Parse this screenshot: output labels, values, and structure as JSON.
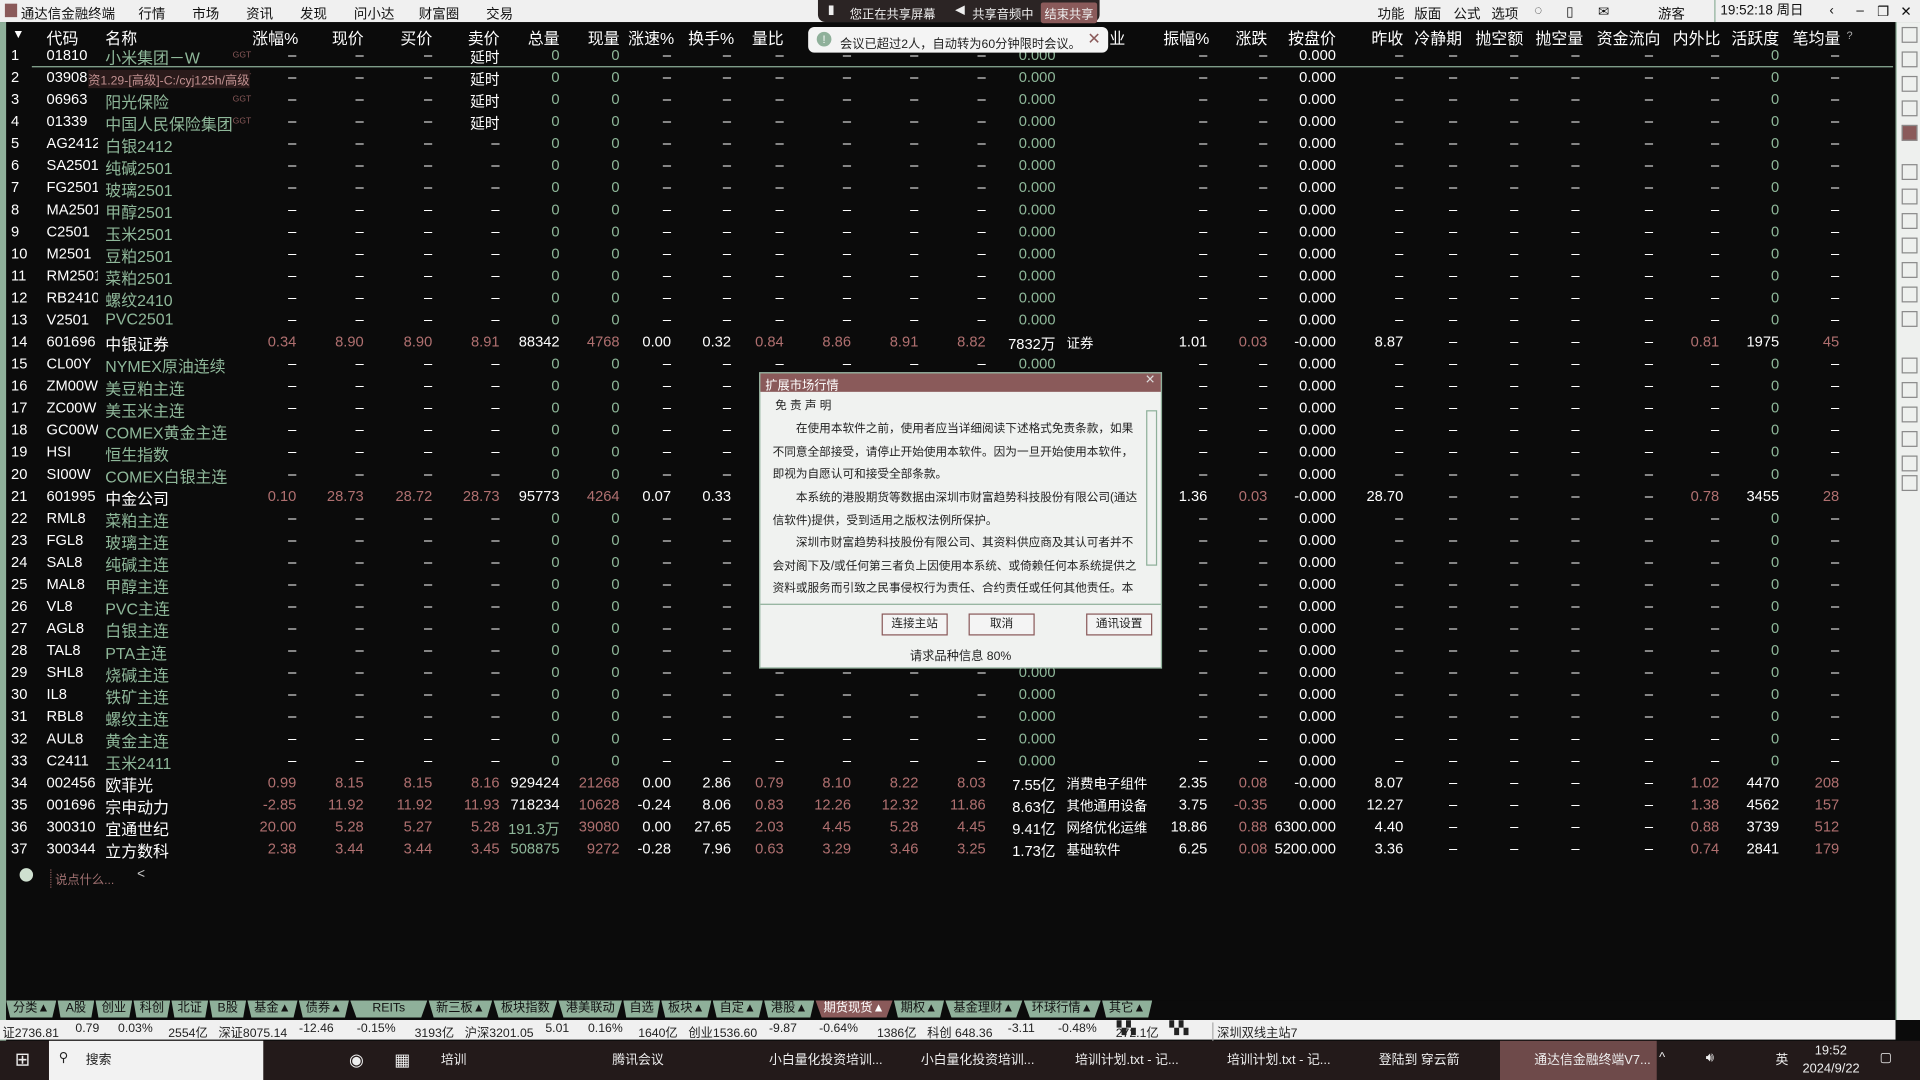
{
  "app": {
    "title": "通达信金融终端",
    "menu": [
      "行情",
      "市场",
      "资讯",
      "发现",
      "问小达",
      "财富圈",
      "交易"
    ],
    "right_menu": [
      "功能",
      "版面",
      "公式",
      "选项"
    ],
    "user": "游客",
    "clock": "19:52:18 周日"
  },
  "share_bar": {
    "sharing": "您正在共享屏幕",
    "audio": "共享音频中",
    "end": "结束共享"
  },
  "toast": {
    "text": "会议已超过2人，自动转为60分钟限时会议。"
  },
  "table": {
    "headers": {
      "code": "代码",
      "name": "名称",
      "chg": "涨幅%",
      "price": "现价",
      "bid": "买价",
      "ask": "卖价",
      "vol": "总量",
      "curvol": "现量",
      "speed": "涨速%",
      "turnover": "换手%",
      "volratio": "量比",
      "industry_tail": "业",
      "amp": "振幅%",
      "change": "涨跌",
      "ref": "按盘价",
      "prev": "昨收",
      "cool": "冷静期",
      "shortamt": "抛空额",
      "shortvol": "抛空量",
      "flow": "资金流向",
      "inout": "内外比",
      "activity": "活跃度",
      "avgvol": "笔均量",
      "help": "?"
    },
    "overlay_title": "资1.29-[高级]-C:/cyj125h/高级",
    "rows": [
      [
        "1",
        "01810",
        "小米集团－W",
        "GGT"
      ],
      [
        "2",
        "03908",
        "",
        "GGT"
      ],
      [
        "3",
        "06963",
        "阳光保险",
        "GGT"
      ],
      [
        "4",
        "01339",
        "中国人民保险集团",
        "GGT"
      ],
      [
        "5",
        "AG2412",
        "白银2412"
      ],
      [
        "6",
        "SA2501",
        "纯碱2501"
      ],
      [
        "7",
        "FG2501",
        "玻璃2501"
      ],
      [
        "8",
        "MA2501",
        "甲醇2501"
      ],
      [
        "9",
        "C2501",
        "玉米2501"
      ],
      [
        "10",
        "M2501",
        "豆粕2501"
      ],
      [
        "11",
        "RM2501",
        "菜粕2501"
      ],
      [
        "12",
        "RB2410",
        "螺纹2410"
      ],
      [
        "13",
        "V2501",
        "PVC2501"
      ],
      [
        "14",
        "601696",
        "中银证券",
        "",
        "0.34",
        "8.90",
        "8.90",
        "8.91",
        "88342",
        "4768",
        "0.00",
        "0.32",
        "0.84",
        "8.86",
        "8.91",
        "8.82",
        "7832万",
        "证券",
        "1.01",
        "0.03",
        "-0.000",
        "8.87",
        "–",
        "–",
        "–",
        "–",
        "0.81",
        "1975",
        "45"
      ],
      [
        "15",
        "CL00Y",
        "NYMEX原油连续"
      ],
      [
        "16",
        "ZM00W",
        "美豆粕主连"
      ],
      [
        "17",
        "ZC00W",
        "美玉米主连"
      ],
      [
        "18",
        "GC00W",
        "COMEX黄金主连"
      ],
      [
        "19",
        "HSI",
        "恒生指数"
      ],
      [
        "20",
        "SI00W",
        "COMEX白银主连"
      ],
      [
        "21",
        "601995",
        "中金公司",
        "",
        "0.10",
        "28.73",
        "28.72",
        "28.73",
        "95773",
        "4264",
        "0.07",
        "0.33",
        "–",
        "–",
        "–",
        "–",
        "–",
        "",
        "1.36",
        "0.03",
        "-0.000",
        "28.70",
        "–",
        "–",
        "–",
        "–",
        "0.78",
        "3455",
        "28"
      ],
      [
        "22",
        "RML8",
        "菜粕主连"
      ],
      [
        "23",
        "FGL8",
        "玻璃主连"
      ],
      [
        "24",
        "SAL8",
        "纯碱主连"
      ],
      [
        "25",
        "MAL8",
        "甲醇主连"
      ],
      [
        "26",
        "VL8",
        "PVC主连"
      ],
      [
        "27",
        "AGL8",
        "白银主连"
      ],
      [
        "28",
        "TAL8",
        "PTA主连"
      ],
      [
        "29",
        "SHL8",
        "烧碱主连"
      ],
      [
        "30",
        "IL8",
        "铁矿主连"
      ],
      [
        "31",
        "RBL8",
        "螺纹主连"
      ],
      [
        "32",
        "AUL8",
        "黄金主连"
      ],
      [
        "33",
        "C2411",
        "玉米2411"
      ],
      [
        "34",
        "002456",
        "欧菲光",
        "",
        "0.99",
        "8.15",
        "8.15",
        "8.16",
        "929424",
        "21268",
        "0.00",
        "2.86",
        "0.79",
        "8.10",
        "8.22",
        "8.03",
        "7.55亿",
        "消费电子组件",
        "2.35",
        "0.08",
        "-0.000",
        "8.07",
        "–",
        "–",
        "–",
        "–",
        "1.02",
        "4470",
        "208"
      ],
      [
        "35",
        "001696",
        "宗申动力",
        "",
        "-2.85",
        "11.92",
        "11.92",
        "11.93",
        "718234",
        "10628",
        "-0.24",
        "8.06",
        "0.83",
        "12.26",
        "12.32",
        "11.86",
        "8.63亿",
        "其他通用设备",
        "3.75",
        "-0.35",
        "0.000",
        "12.27",
        "–",
        "–",
        "–",
        "–",
        "1.38",
        "4562",
        "157"
      ],
      [
        "36",
        "300310",
        "宜通世纪",
        "",
        "20.00",
        "5.28",
        "5.27",
        "5.28",
        "191.3万",
        "39080",
        "0.00",
        "27.65",
        "2.03",
        "4.45",
        "5.28",
        "4.45",
        "9.41亿",
        "网络优化运维",
        "18.86",
        "0.88",
        "6300.000",
        "4.40",
        "–",
        "–",
        "–",
        "–",
        "0.88",
        "3739",
        "512"
      ],
      [
        "37",
        "300344",
        "立方数科",
        "",
        "2.38",
        "3.44",
        "3.44",
        "3.45",
        "508875",
        "9272",
        "-0.28",
        "7.96",
        "0.63",
        "3.29",
        "3.46",
        "3.25",
        "1.73亿",
        "基础软件",
        "6.25",
        "0.08",
        "5200.000",
        "3.36",
        "–",
        "–",
        "–",
        "–",
        "0.74",
        "2841",
        "179"
      ]
    ],
    "delayed_label": "延时",
    "dash": "–",
    "zero": "0",
    "zero_amount": "0.000"
  },
  "chat": {
    "placeholder": "说点什么...",
    "collapse": "<"
  },
  "dialog": {
    "title": "扩展市场行情",
    "heading": "免 责 声 明",
    "p1": "在使用本软件之前，使用者应当详细阅读下述格式免责条款，如果不同意全部接受，请停止开始使用本软件。因为一旦开始使用本软件，即视为自愿认可和接受全部条款。",
    "p2": "本系统的港股期货等数据由深圳市财富趋势科技股份有限公司(通达信软件)提供，受到适用之版权法例所保护。",
    "p3": "深圳市财富趋势科技股份有限公司、其资料供应商及其认可者并不会对阁下及/或任何第三者负上因使用本系统、或倚赖任何本系统提供之资料或服务而引致之民事侵权行为责任、合约责任或任何其他责任。本软",
    "btn_connect": "连接主站",
    "btn_cancel": "取消",
    "btn_settings": "通讯设置",
    "progress_text": "请求品种信息 80%"
  },
  "tabs": [
    "分类▲",
    "A股",
    "创业",
    "科创",
    "北证",
    "B股",
    "基金▲",
    "债券▲",
    "REITs",
    "新三板▲",
    "板块指数",
    "港美联动",
    "自选",
    "板块▲",
    "自定▲",
    "港股▲",
    "期货现货▲",
    "期权▲",
    "基金理财▲",
    "环球行情▲",
    "其它▲"
  ],
  "active_tab": "期货现货▲",
  "status": {
    "items": [
      "证2736.81",
      "0.79",
      "0.03%",
      "2554亿",
      "深证8075.14",
      "-12.46",
      "-0.15%",
      "3193亿",
      "沪深3201.05",
      "5.01",
      "0.16%",
      "1640亿",
      "创业1536.60",
      "-9.87",
      "-0.64%",
      "1386亿",
      "科创 648.36",
      "-3.11",
      "-0.48%",
      "272.1亿"
    ],
    "server": "深圳双线主站7"
  },
  "taskbar": {
    "search": "搜索",
    "apps": [
      "培训",
      "腾讯会议",
      "小白量化投资培训...",
      "小白量化投资培训...",
      "培训计划.txt - 记...",
      "培训计划.txt - 记...",
      "登陆到 穿云箭",
      "通达信金融终端V7..."
    ],
    "ime": "英",
    "time": "19:52",
    "date": "2024/9/22"
  }
}
